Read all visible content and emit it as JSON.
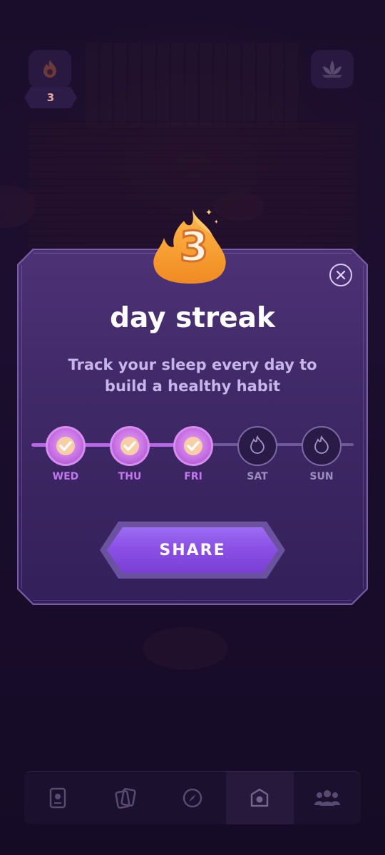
{
  "hud": {
    "streak_count": "3",
    "streak_icon": "flame-icon",
    "profile_icon": "lotus-icon"
  },
  "modal": {
    "streak_number": "3",
    "title": "day streak",
    "subtitle": "Track your sleep every day to build a healthy habit",
    "close_icon": "close-icon",
    "share_label": "SHARE",
    "days": [
      {
        "label": "WED",
        "completed": true
      },
      {
        "label": "THU",
        "completed": true
      },
      {
        "label": "FRI",
        "completed": true
      },
      {
        "label": "SAT",
        "completed": false
      },
      {
        "label": "SUN",
        "completed": false
      }
    ]
  },
  "bottom_nav": {
    "items": [
      {
        "icon": "journal-icon"
      },
      {
        "icon": "cards-icon"
      },
      {
        "icon": "compass-icon"
      },
      {
        "icon": "home-icon",
        "active": true
      },
      {
        "icon": "friends-icon"
      }
    ]
  },
  "colors": {
    "accent": "#b866e4",
    "button": "#8a4ee4",
    "flame": "#f5a93a"
  }
}
